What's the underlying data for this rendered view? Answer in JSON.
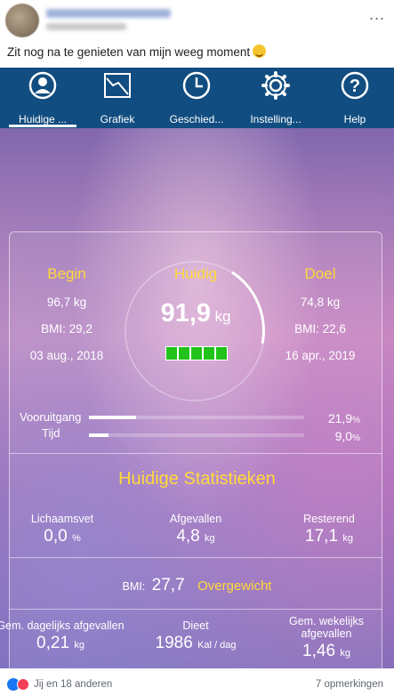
{
  "post": {
    "caption": "Zit nog na te genieten van mijn weeg moment",
    "emoji_icon": "grinning-face-emoji",
    "menu_label": "..."
  },
  "app": {
    "tabs": [
      {
        "label": "Huidige ...",
        "icon": "user-icon"
      },
      {
        "label": "Grafiek",
        "icon": "chart-icon"
      },
      {
        "label": "Geschied...",
        "icon": "clock-icon"
      },
      {
        "label": "Instelling...",
        "icon": "gear-icon"
      },
      {
        "label": "Help",
        "icon": "help-icon"
      }
    ],
    "active_tab": "Huidige ...",
    "begin": {
      "heading": "Begin",
      "weight": "96,7 kg",
      "bmi": "BMI: 29,2",
      "date": "03 aug., 2018"
    },
    "current": {
      "heading": "Huidig",
      "value": "91,9",
      "unit": "kg",
      "progress_blocks": 5
    },
    "goal": {
      "heading": "Doel",
      "weight": "74,8 kg",
      "bmi": "BMI: 22,6",
      "date": "16 apr., 2019"
    },
    "progress": [
      {
        "label": "Vooruitgang",
        "value": "21,9",
        "unit": "%",
        "fraction": 0.219
      },
      {
        "label": "Tijd",
        "value": "9,0",
        "unit": "%",
        "fraction": 0.09
      }
    ],
    "stats_title": "Huidige Statistieken",
    "stats_row1": [
      {
        "label": "Lichaamsvet",
        "value": "0,0",
        "unit": "%"
      },
      {
        "label": "Afgevallen",
        "value": "4,8",
        "unit": "kg"
      },
      {
        "label": "Resterend",
        "value": "17,1",
        "unit": "kg"
      }
    ],
    "bmi_row": {
      "label": "BMI:",
      "value": "27,7",
      "category": "Overgewicht"
    },
    "stats_row2": [
      {
        "label": "Gem. dagelijks afgevallen",
        "value": "0,21",
        "unit": "kg"
      },
      {
        "label": "Dieet",
        "value": "1986",
        "unit": "Kal / dag"
      },
      {
        "label": "Gem. wekelijks afgevallen",
        "value": "1,46",
        "unit": "kg"
      }
    ],
    "colors": {
      "navbar": "#114d80",
      "accent_yellow": "#ffd93a",
      "block_green": "#21c21a"
    }
  },
  "footer": {
    "reactions_text": "Jij en 18 anderen",
    "comments_text": "7 opmerkingen"
  }
}
